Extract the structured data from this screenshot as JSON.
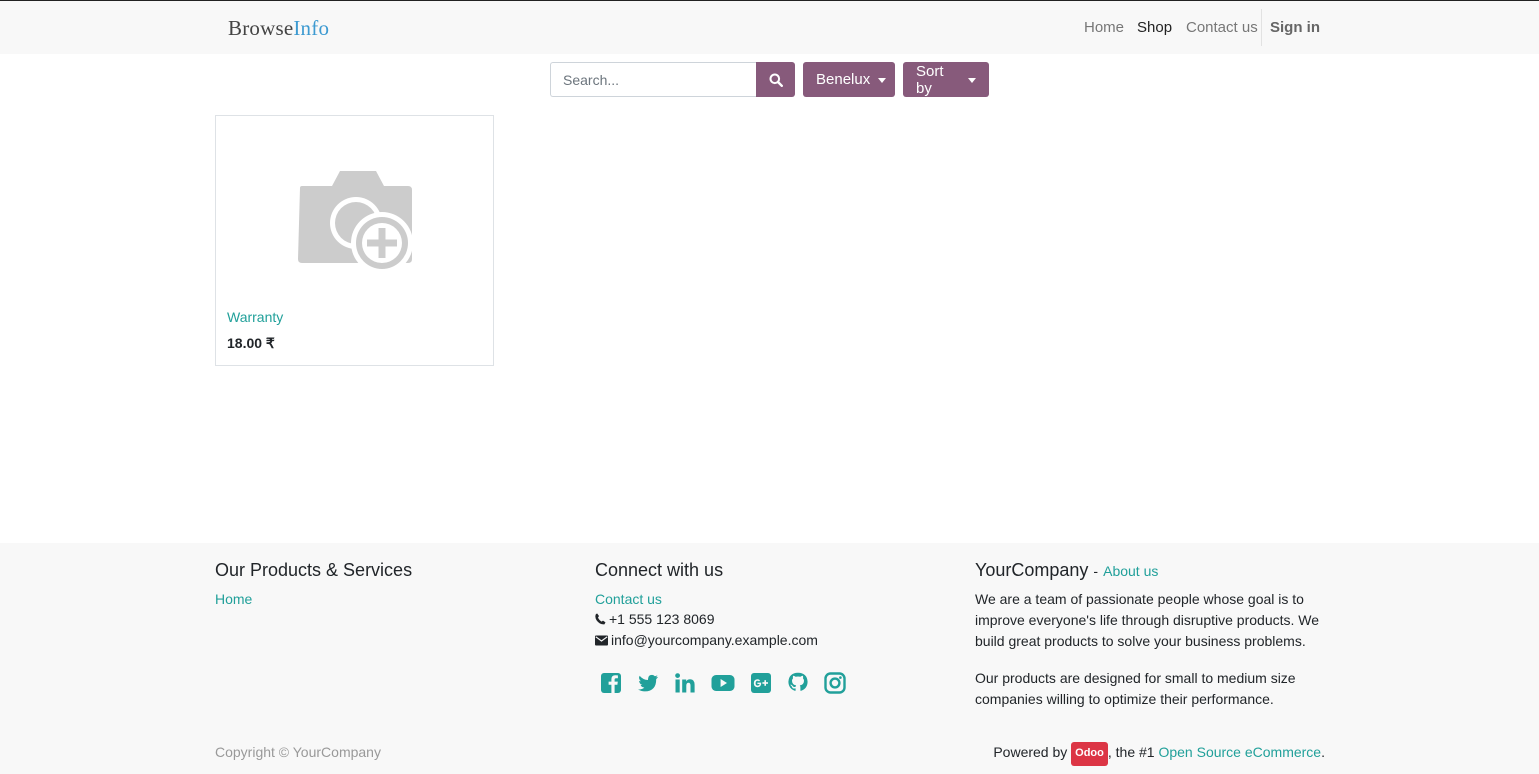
{
  "header": {
    "logo_part1": "Browse",
    "logo_part2": "Info",
    "logo_colors": {
      "dark": "#444444",
      "accent": "#3d9ad1"
    },
    "nav": {
      "home": "Home",
      "shop": "Shop",
      "contact": "Contact us",
      "signin": "Sign in"
    },
    "active_nav": "Shop"
  },
  "toolbar": {
    "search_placeholder": "Search...",
    "search_value": "",
    "search_icon": "search-icon",
    "pricelist_label": "Benelux",
    "sort_label": "Sort by",
    "button_color": "#875a7b"
  },
  "products": [
    {
      "name": "Warranty",
      "price": "18.00 ₹",
      "image_icon": "camera-plus-placeholder"
    }
  ],
  "footer": {
    "col1": {
      "heading": "Our Products & Services",
      "link_home": "Home"
    },
    "col2": {
      "heading": "Connect with us",
      "link_contact": "Contact us",
      "phone": "+1 555 123 8069",
      "email": "info@yourcompany.example.com",
      "social_icons": [
        "facebook-icon",
        "twitter-icon",
        "linkedin-icon",
        "youtube-icon",
        "google-plus-icon",
        "github-icon",
        "instagram-icon"
      ]
    },
    "col3": {
      "company": "YourCompany",
      "separator": "-",
      "about_link": "About us",
      "para1_line1": "We are a team of passionate people whose goal is to",
      "para1_line2": "improve everyone's life through disruptive products. We",
      "para1_line3": "build great products to solve your business problems.",
      "para2_line1": "Our products are designed for small to medium size",
      "para2_line2": "companies willing to optimize their performance."
    },
    "copyright": "Copyright © YourCompany",
    "powered_prefix": "Powered by",
    "powered_badge": "Odoo",
    "powered_middle": ", the #1",
    "powered_link": "Open Source eCommerce",
    "powered_suffix": ".",
    "link_color": "#21a09a"
  }
}
